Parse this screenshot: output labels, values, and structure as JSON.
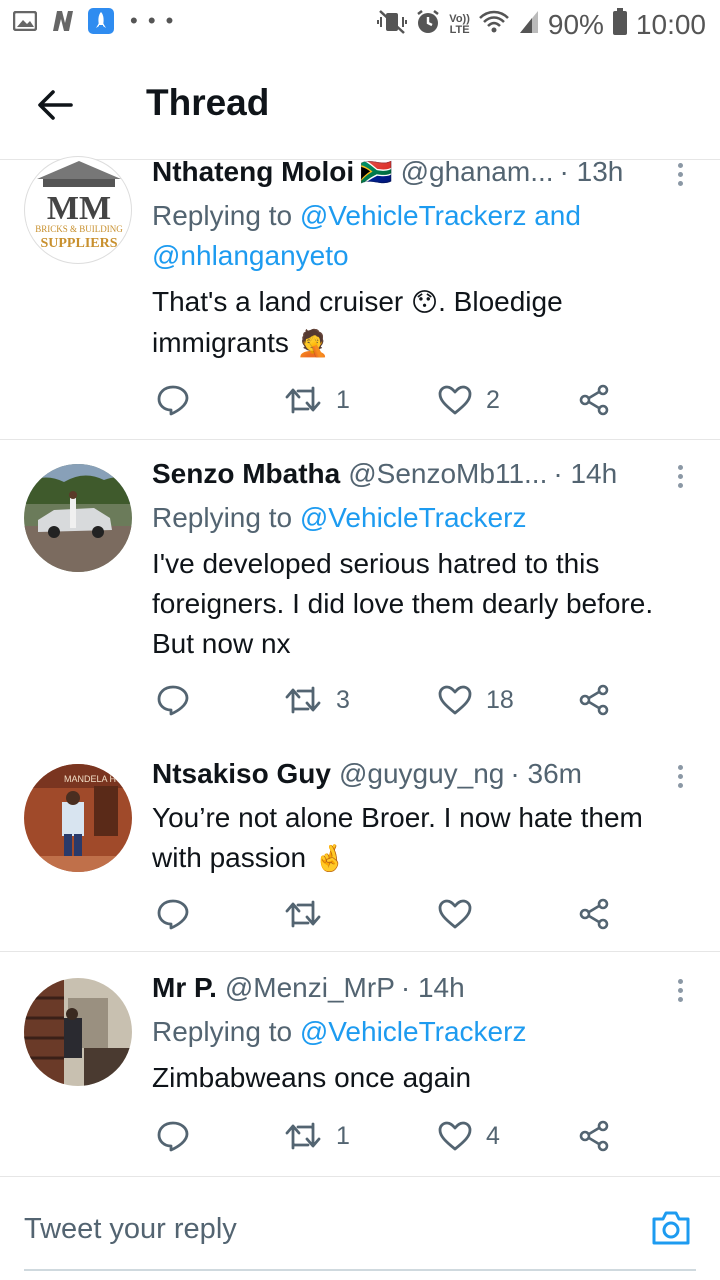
{
  "status_bar": {
    "battery": "90%",
    "time": "10:00",
    "lte_top": "Vo))",
    "lte_bottom": "LTE",
    "more_dots": "• • •"
  },
  "header": {
    "title": "Thread",
    "back_icon": "arrow-left-icon"
  },
  "tweets": [
    {
      "name": "Nthateng Moloi",
      "flag": "🇿🇦",
      "handle": "@ghanam...",
      "time": "· 13h",
      "replying_prefix": "Replying to ",
      "replying_mention_1": "@VehicleTrackerz",
      "replying_joiner": " and",
      "replying_mention_2": "@nhlanganyeto",
      "text_1": "That's a land cruiser ",
      "emoji_1": "😯",
      "text_2": ". Bloedige",
      "text_3": "immigrants ",
      "emoji_2": "🤦",
      "avatar_text": "MM",
      "avatar_subtext": "BRICKS & BUILDING",
      "avatar_subtext2": "SUPPLIERS",
      "retweets": "1",
      "likes": "2"
    },
    {
      "name": "Senzo  Mbatha",
      "handle": "@SenzoMb11...",
      "time": "· 14h",
      "replying_prefix": "Replying to ",
      "replying_mention_1": "@VehicleTrackerz",
      "text_line_1": "I've developed serious hatred to this",
      "text_line_2": "foreigners. I did love them dearly before.",
      "text_line_3": "But now nx",
      "retweets": "3",
      "likes": "18"
    },
    {
      "name": "Ntsakiso Guy",
      "handle": "@guyguy_ng",
      "time": "· 36m",
      "text_line_1": "You’re not alone Broer. I now hate them",
      "text_line_2": "with passion ",
      "emoji_1": "🤞",
      "avatar_sign": "MANDELA HOUS",
      "retweets": "",
      "likes": ""
    },
    {
      "name": "Mr P.",
      "handle": "@Menzi_MrP",
      "time": "· 14h",
      "replying_prefix": "Replying to ",
      "replying_mention_1": "@VehicleTrackerz",
      "text_line_1": "Zimbabweans once again",
      "retweets": "1",
      "likes": "4"
    }
  ],
  "reply_bar": {
    "placeholder": "Tweet your reply",
    "camera_icon": "camera-icon"
  },
  "colors": {
    "accent": "#1d9bf0",
    "secondary_text": "#536471",
    "primary_text": "#0f1419"
  }
}
